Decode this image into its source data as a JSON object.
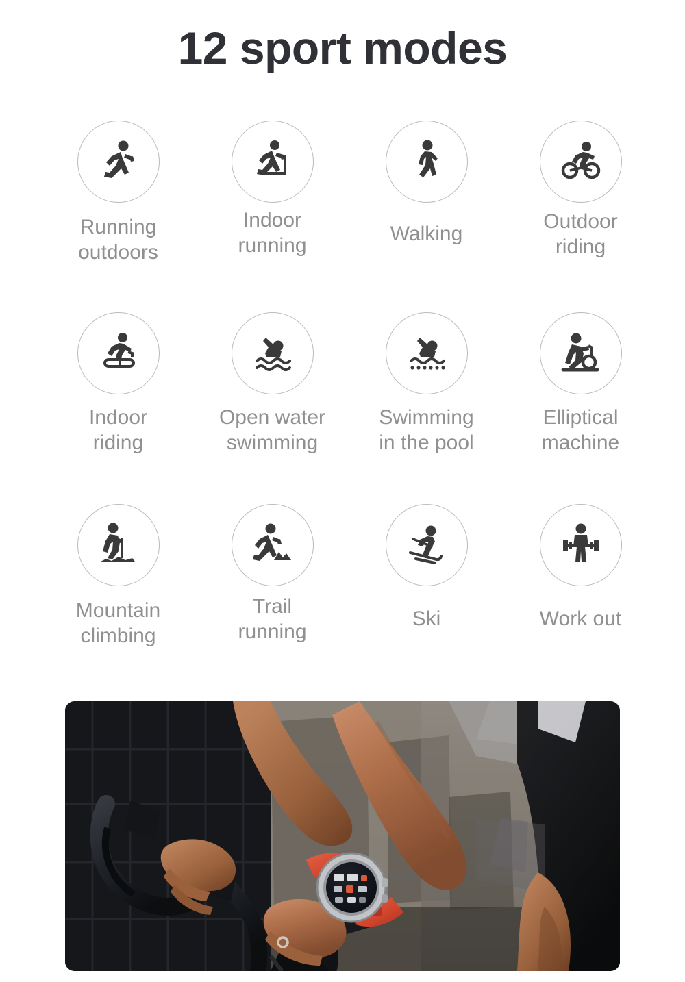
{
  "page": {
    "title": "12 sport modes",
    "background_color": "#ffffff",
    "title_color": "#2f3136",
    "label_color": "#8e9092",
    "circle_border_color": "#b9bbbd",
    "icon_color": "#3a3a3a"
  },
  "modes": [
    {
      "label": "Running\noutdoors",
      "icon": "running-outdoors-icon",
      "single_line": false
    },
    {
      "label": "Indoor\nrunning",
      "icon": "indoor-running-icon",
      "single_line": false
    },
    {
      "label": "Walking",
      "icon": "walking-icon",
      "single_line": true
    },
    {
      "label": "Outdoor\nriding",
      "icon": "outdoor-riding-icon",
      "single_line": false
    },
    {
      "label": "Indoor\nriding",
      "icon": "indoor-riding-icon",
      "single_line": false
    },
    {
      "label": "Open water\nswimming",
      "icon": "open-water-swimming-icon",
      "single_line": false
    },
    {
      "label": "Swimming\nin the pool",
      "icon": "pool-swimming-icon",
      "single_line": false
    },
    {
      "label": "Elliptical\nmachine",
      "icon": "elliptical-machine-icon",
      "single_line": false
    },
    {
      "label": "Mountain\nclimbing",
      "icon": "mountain-climbing-icon",
      "single_line": false
    },
    {
      "label": "Trail\nrunning",
      "icon": "trail-running-icon",
      "single_line": false
    },
    {
      "label": "Ski",
      "icon": "ski-icon",
      "single_line": true
    },
    {
      "label": "Work out",
      "icon": "work-out-icon",
      "single_line": true
    }
  ],
  "photo": {
    "name": "cyclist-wearing-smartwatch-photo",
    "description": "Close-up of a cyclist's hands gripping road bike drop handlebars while wearing a round smartwatch with an orange-red silicone strap",
    "watch_strap_color": "#e4533a",
    "watch_bezel_color": "#d8d8d8",
    "watch_face_color": "#15181f"
  }
}
